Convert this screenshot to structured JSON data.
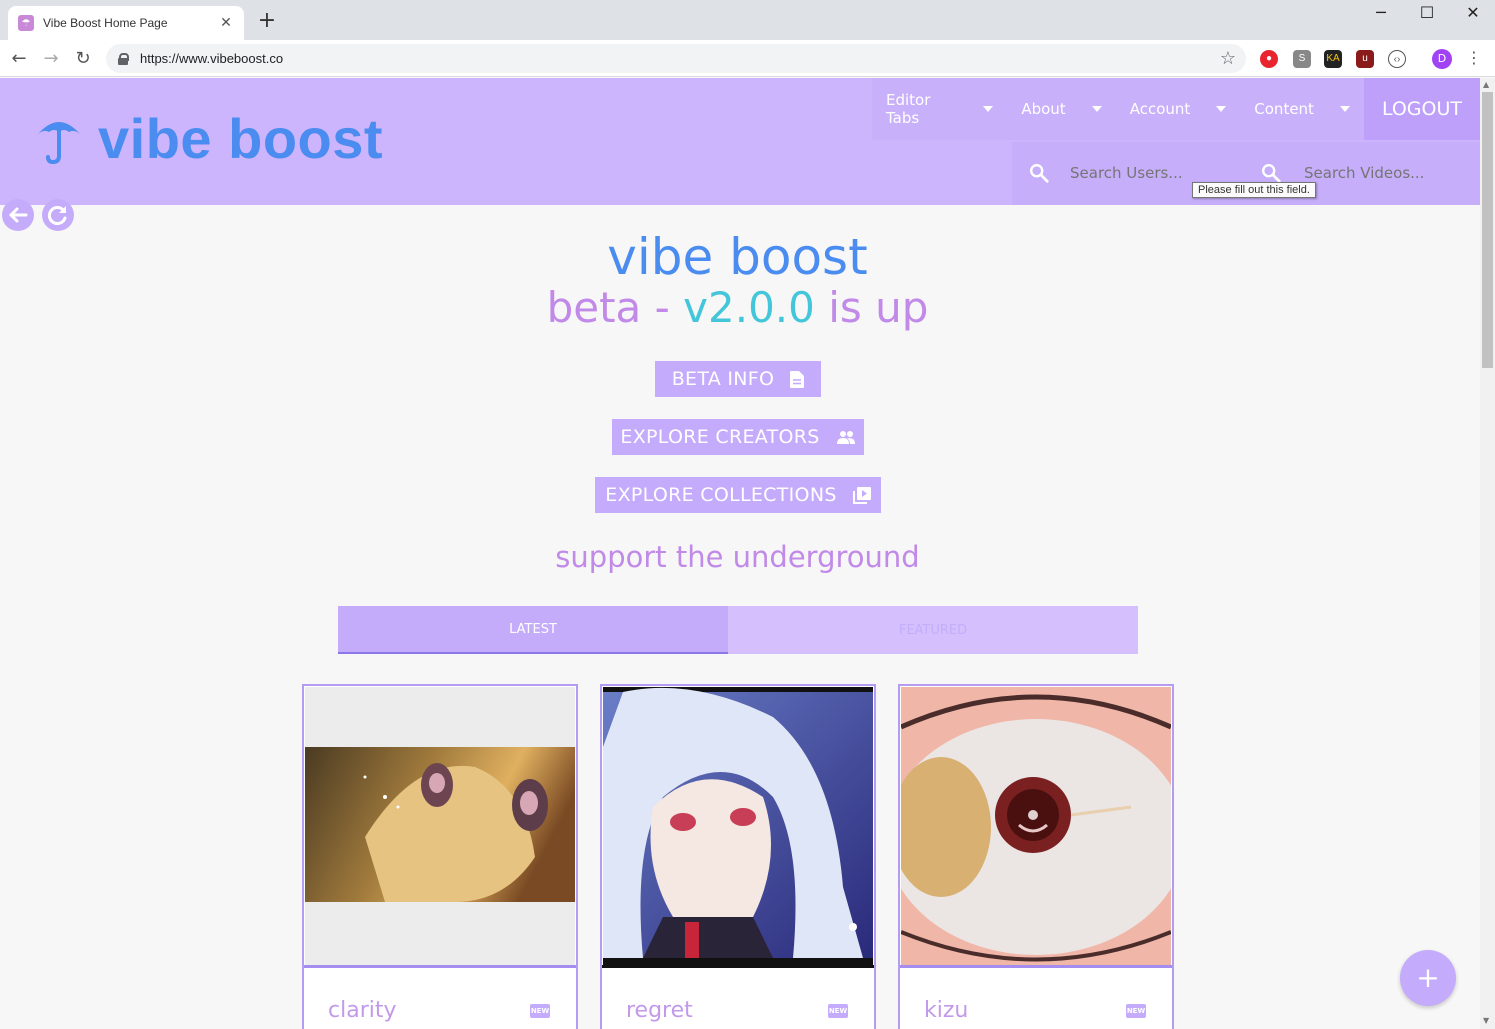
{
  "browser": {
    "tab_title": "Vibe Boost Home Page",
    "url": "https://www.vibeboost.co",
    "profile_initial": "D"
  },
  "header": {
    "brand": "vibe boost",
    "menu": [
      {
        "label": "Editor Tabs"
      },
      {
        "label": "About"
      },
      {
        "label": "Account"
      },
      {
        "label": "Content"
      }
    ],
    "logout_label": "LOGOUT",
    "search_users_placeholder": "Search Users...",
    "search_videos_placeholder": "Search Videos...",
    "tooltip": "Please fill out this field."
  },
  "hero": {
    "title": "vibe boost",
    "sub_beta": "beta -",
    "sub_version": "v2.0.0",
    "sub_status": "is up"
  },
  "buttons": {
    "beta_info": "BETA INFO",
    "explore_creators": "EXPLORE CREATORS",
    "explore_collections": "EXPLORE COLLECTIONS"
  },
  "tagline": "support the underground",
  "feed_tabs": {
    "latest": "LATEST",
    "featured": "FEATURED"
  },
  "cards": [
    {
      "title": "clarity",
      "badge": "NEW"
    },
    {
      "title": "regret",
      "badge": "NEW"
    },
    {
      "title": "kizu",
      "badge": "NEW"
    }
  ],
  "fab_label": "+",
  "colors": {
    "brand_blue": "#4a8cf0",
    "lavender": "#c5abfb",
    "pink_text": "#c18ae8",
    "cyan_version": "#43c6d9"
  }
}
